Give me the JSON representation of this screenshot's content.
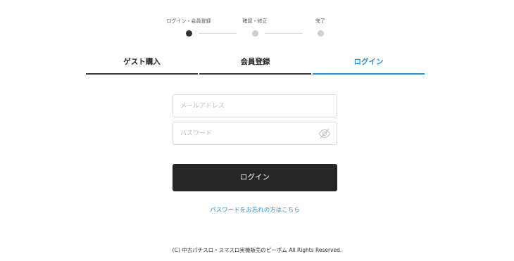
{
  "stepper": {
    "steps": [
      {
        "label": "ログイン・会員登録",
        "active": true
      },
      {
        "label": "確認・修正",
        "active": false
      },
      {
        "label": "完了",
        "active": false
      }
    ]
  },
  "tabs": [
    {
      "label": "ゲスト購入",
      "active": false
    },
    {
      "label": "会員登録",
      "active": false
    },
    {
      "label": "ログイン",
      "active": true
    }
  ],
  "form": {
    "email_placeholder": "メールアドレス",
    "email_value": "",
    "password_placeholder": "パスワード",
    "password_value": "",
    "password_toggle_icon": "eye-slash-icon",
    "submit_label": "ログイン",
    "forgot_label": "パスワードをお忘れの方はこちら"
  },
  "footer": {
    "copyright": "(C) 中古パチスロ・スマスロ実機販売のピーポム All Rights Reserved."
  },
  "colors": {
    "accent": "#2b8fd6",
    "button_bg": "#262626",
    "active_dot": "#333333",
    "inactive_dot": "#cfcfcf"
  }
}
